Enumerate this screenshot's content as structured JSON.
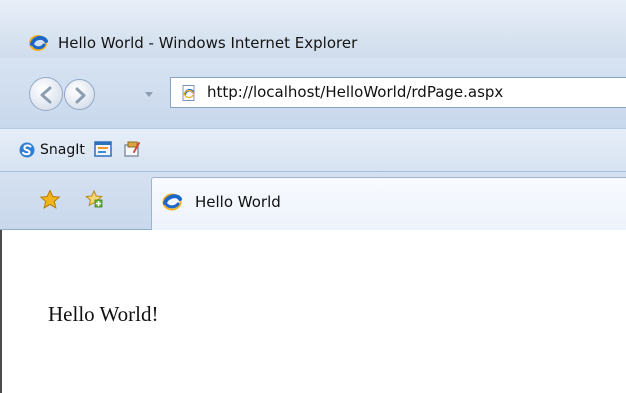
{
  "window": {
    "title": "Hello World - Windows Internet Explorer"
  },
  "navigation": {
    "address_url": "http://localhost/HelloWorld/rdPage.aspx"
  },
  "toolbar": {
    "snagit_label": "SnagIt"
  },
  "tabs": [
    {
      "label": "Hello World",
      "active": true
    }
  ],
  "content": {
    "text": "Hello World!"
  },
  "icons": {
    "browser": "ie-icon",
    "back": "back-arrow-icon",
    "forward": "forward-arrow-icon",
    "page": "page-icon",
    "snagit": "snagit-icon",
    "capture": "capture-icon",
    "edit": "edit-icon",
    "favorites": "star-icon",
    "add_favorites": "add-favorites-icon"
  },
  "colors": {
    "chrome_blue": "#cfdcee",
    "border_blue": "#8ca2c3",
    "ie_blue": "#1f67c8",
    "ie_orange": "#f2b01e",
    "star_gold": "#f0b51d",
    "plus_green": "#62b72e"
  }
}
